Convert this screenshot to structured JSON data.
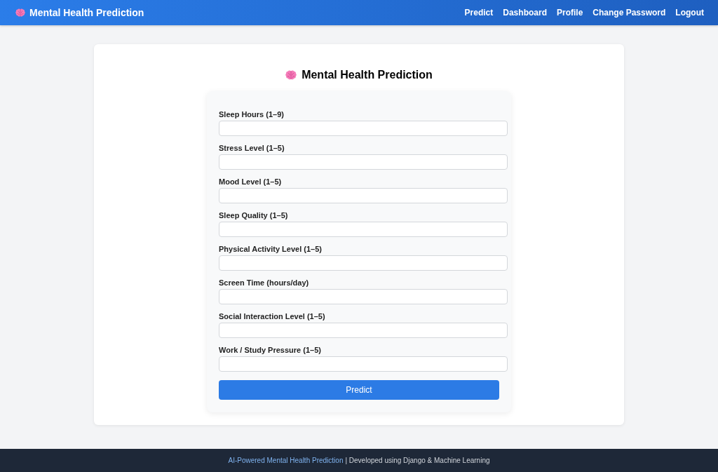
{
  "navbar": {
    "brand": "Mental Health Prediction",
    "links": [
      "Predict",
      "Dashboard",
      "Profile",
      "Change Password",
      "Logout"
    ]
  },
  "form": {
    "title": "Mental Health Prediction",
    "fields": [
      {
        "label": "Sleep Hours (1–9)"
      },
      {
        "label": "Stress Level (1–5)"
      },
      {
        "label": "Mood Level (1–5)"
      },
      {
        "label": "Sleep Quality (1–5)"
      },
      {
        "label": "Physical Activity Level (1–5)"
      },
      {
        "label": "Screen Time (hours/day)"
      },
      {
        "label": "Social Interaction Level (1–5)"
      },
      {
        "label": "Work / Study Pressure (1–5)"
      }
    ],
    "submit": "Predict"
  },
  "footer": {
    "highlight": "AI-Powered Mental Health Prediction",
    "text": "| Developed using Django & Machine Learning"
  }
}
